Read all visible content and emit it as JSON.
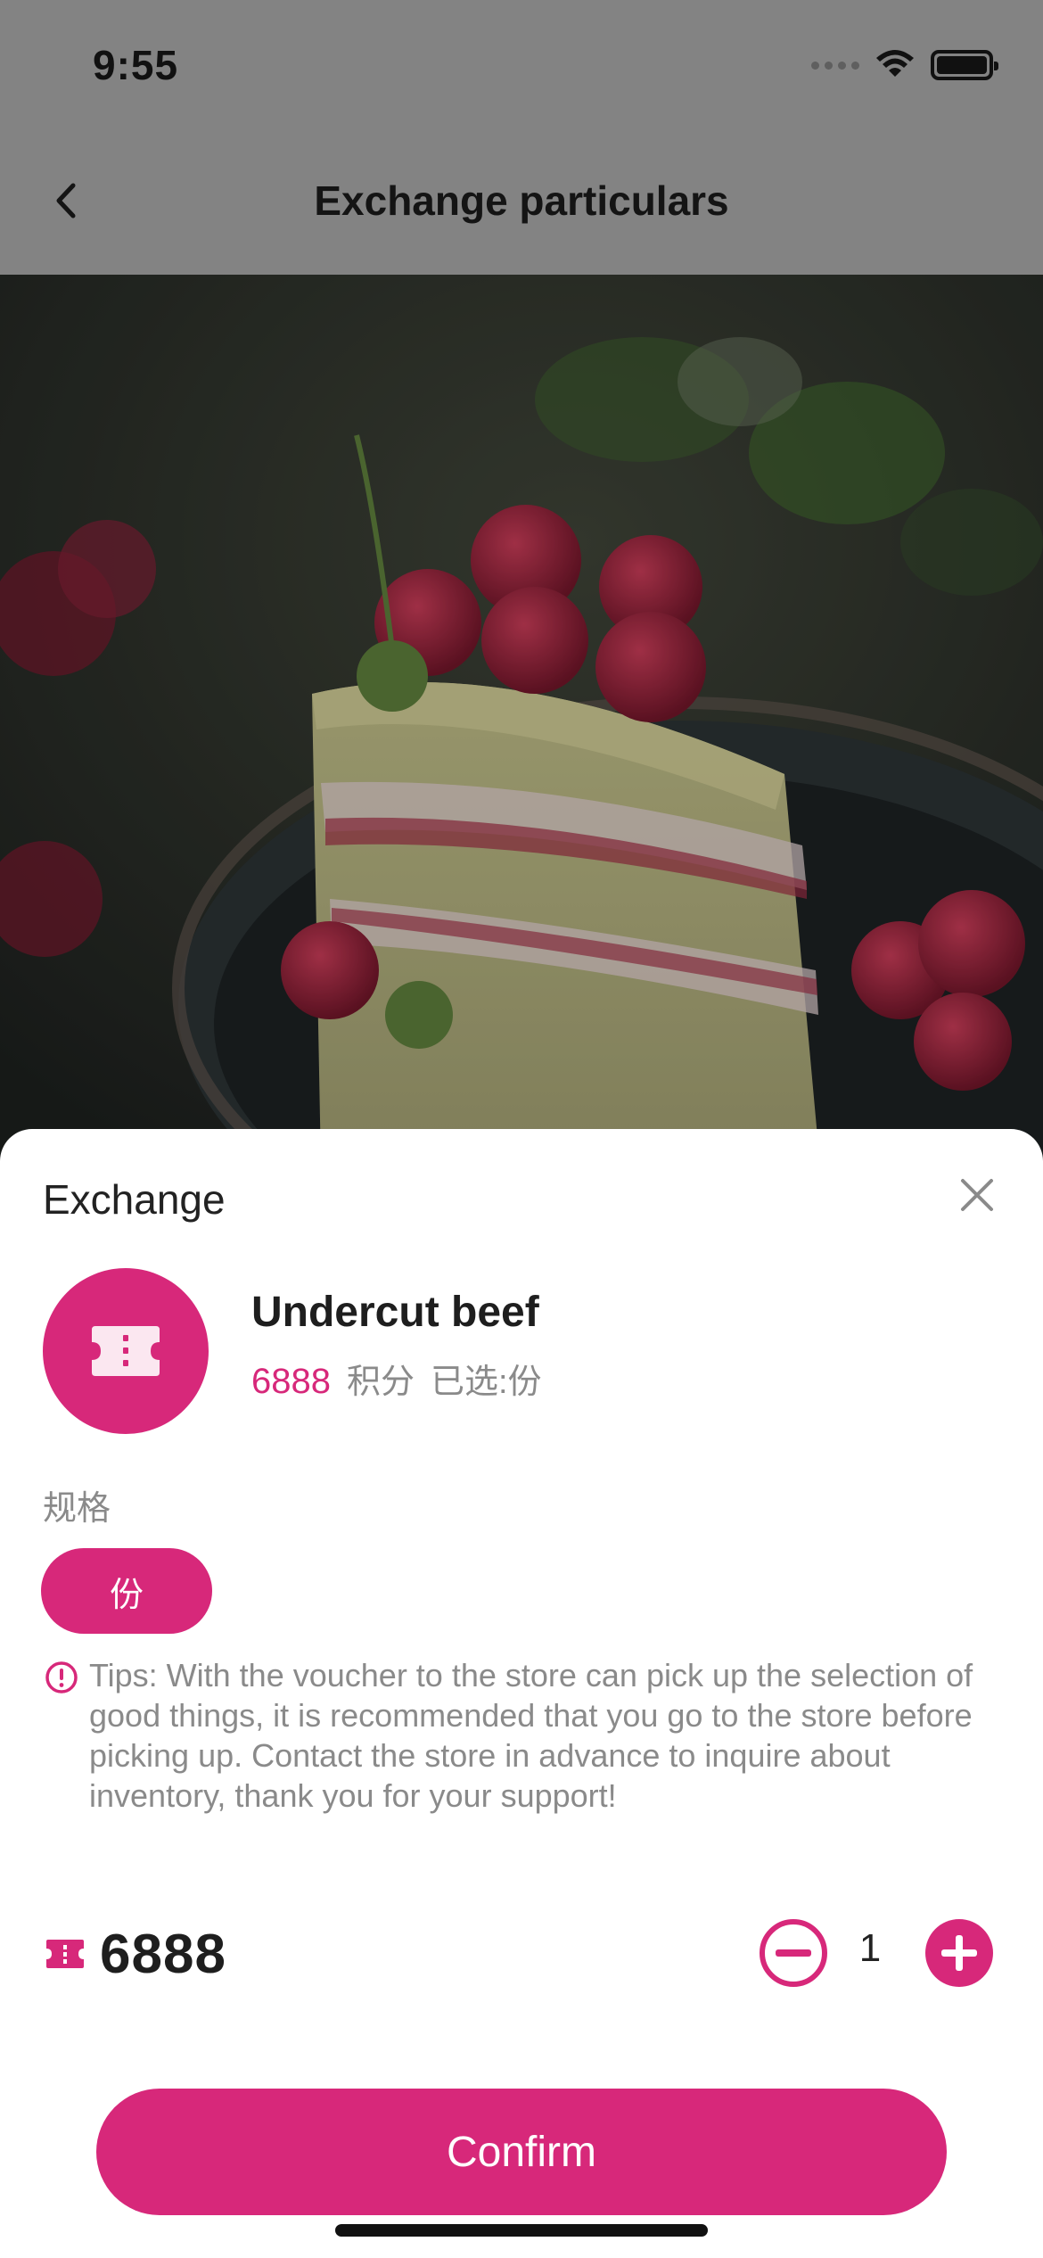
{
  "status_bar": {
    "time": "9:55"
  },
  "nav": {
    "title": "Exchange particulars",
    "back_icon": "chevron-left-icon"
  },
  "sheet": {
    "title": "Exchange",
    "close_icon": "close-icon",
    "product": {
      "icon": "ticket-icon",
      "name": "Undercut beef",
      "points": "6888",
      "points_unit": "积分",
      "selected": "已选:份"
    },
    "spec": {
      "label": "规格",
      "option": "份"
    },
    "tips": {
      "icon": "alert-circle-icon",
      "text": "Tips: With the voucher to the store can pick up the selection of good things, it is recommended that you go to the store before picking up. Contact the store in advance to inquire about inventory, thank you for your support!"
    },
    "total": {
      "icon": "ticket-icon",
      "value": "6888"
    },
    "quantity": {
      "value": "1",
      "minus_icon": "minus-circle-icon",
      "plus_icon": "plus-circle-icon"
    },
    "confirm_label": "Confirm"
  },
  "colors": {
    "accent": "#d7287a",
    "overlay_gray": "#838383",
    "text_dark": "#1e1e1e",
    "text_muted": "#8a8a8a"
  }
}
